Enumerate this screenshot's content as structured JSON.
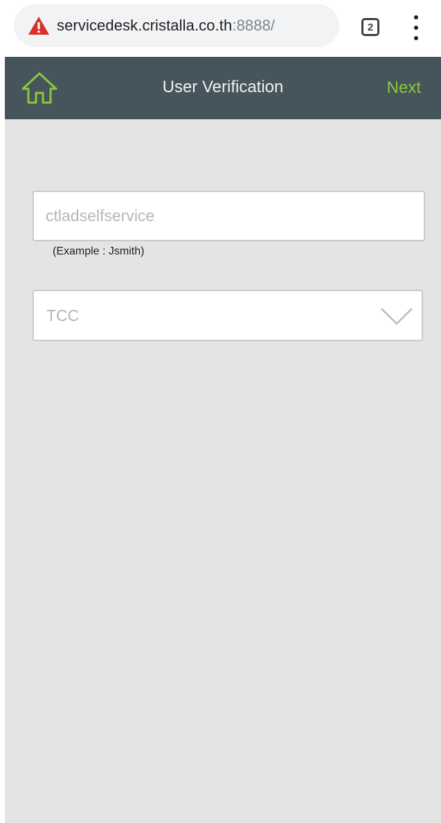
{
  "browser": {
    "url_host": "servicedesk.cristalla.co.th",
    "url_port": ":8888/",
    "tab_count": "2",
    "warning_icon": "warning-triangle-icon",
    "menu_icon": "more-vert-icon",
    "warning_color": "#d93025"
  },
  "header": {
    "title": "User Verification",
    "next_label": "Next",
    "home_icon": "home-icon",
    "background_color": "#46545c",
    "accent_color": "#8cc63f"
  },
  "form": {
    "username": {
      "value": "",
      "placeholder": "ctladselfservice",
      "hint": "(Example : Jsmith)"
    },
    "domain": {
      "selected": "TCC",
      "dropdown_icon": "chevron-down-icon"
    }
  }
}
